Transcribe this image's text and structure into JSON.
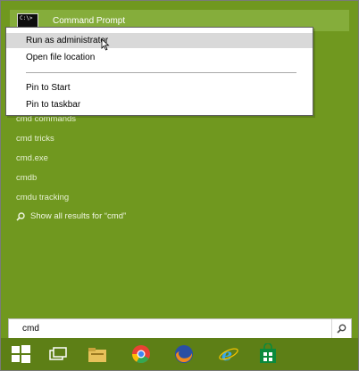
{
  "start_menu": {
    "top_result": "Command Prompt",
    "context_menu": [
      "Run as administrator",
      "Open file location",
      "Pin to Start",
      "Pin to taskbar"
    ],
    "suggestions": [
      "cmd commands",
      "cmd tricks",
      "cmd.exe",
      "cmdb",
      "cmdu tracking"
    ],
    "show_all": "Show all results for “cmd”"
  },
  "search": {
    "value": "cmd"
  },
  "colors": {
    "accent": "#70981f",
    "selected": "#85ad3b",
    "taskbar": "#5d7f16"
  },
  "taskbar": [
    "windows-start-icon",
    "task-view-icon",
    "file-explorer-icon",
    "chrome-icon",
    "firefox-icon",
    "internet-explorer-icon",
    "store-icon"
  ]
}
